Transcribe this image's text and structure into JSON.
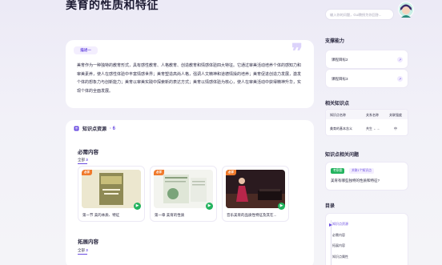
{
  "header": {
    "title": "美育的性质和特征",
    "search_placeholder": "输入你的问题，Gui教授为你回答..."
  },
  "intro": {
    "tag": "描述一",
    "quote_mark": "❞",
    "text": "美育作为一种独特的教育形式，具有感性教育、人格教育、创造教育和情感体验四大特征。它通过审美活动培养个体的感知力和审美素养，使人在感性体验中丰富情感世界；美育塑造高尚人格，强调人文精神和道德情操的培养；美育促进创造力发展，激发个体的想象力与创新能力；美育以审美实践中探索新的表达方式；美育以情感体验为核心，使人在审美活动中获得精神升华，实现个体的全面发展。"
  },
  "resources": {
    "title": "知识点资源",
    "count": "· 6",
    "required": {
      "title": "必需内容",
      "filter_all": "全部",
      "filter_count": "3",
      "items": [
        {
          "badge": "必学",
          "label": "第一节 美的本质、特征"
        },
        {
          "badge": "必学",
          "label": "第一章 美育的性质"
        },
        {
          "badge": "必学",
          "label": "音乐美育的品质性特征及其在..."
        }
      ]
    },
    "extended": {
      "title": "拓展内容",
      "filter_all": "全部",
      "filter_count": "3"
    }
  },
  "side": {
    "ability_title": "支撑能力",
    "abilities": [
      {
        "label": "课程目标2"
      },
      {
        "label": "课程目标3"
      }
    ],
    "related_title": "相关知识点",
    "table": {
      "headers": [
        "知识点名称",
        "关系名称",
        "关联强度"
      ],
      "row": [
        "美育的基本含义",
        "共生 ←→",
        "中"
      ]
    },
    "qa_title": "知识点相关问题",
    "qa": {
      "tag": "考察题",
      "tag2": "关联1个知识点",
      "question": "美育有哪些独特的性质和特征?"
    },
    "toc_title": "目录",
    "toc": [
      "知识点资源",
      "必需内容",
      "拓展内容",
      "知识点属性"
    ]
  },
  "colors": {
    "accent": "#6a4ce0",
    "badge": "#f07a2c",
    "play": "#22b35e"
  }
}
